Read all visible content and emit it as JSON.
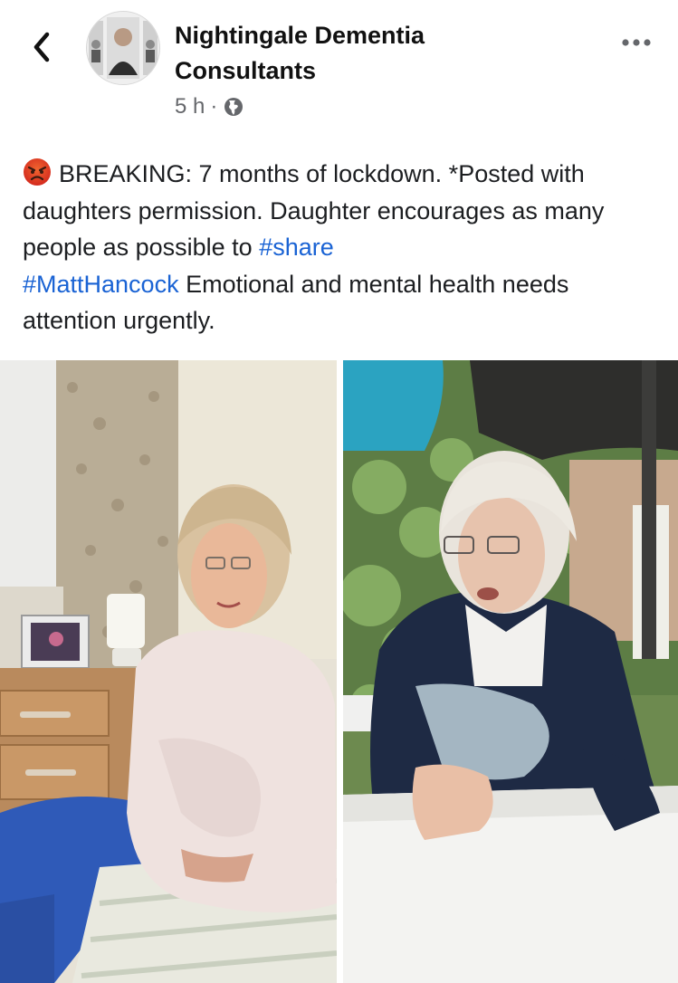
{
  "header": {
    "page_name_line1": "Nightingale Dementia",
    "page_name_line2": "Consultants",
    "timestamp": "5 h",
    "separator": "·",
    "audience_icon": "globe-icon",
    "back_icon": "chevron-left-icon",
    "more_icon": "more-horizontal-icon"
  },
  "post": {
    "emoji": "angry-face-icon",
    "text_before_share": "BREAKING: 7 months of lockdown. *Posted with daughters permission. Daughter encourages as many people as possible to ",
    "hashtag_share": "#share",
    "hashtag_matthancock": "#MattHancock",
    "text_after_hashtags": " Emotional and mental health needs attention urgently."
  },
  "photos": [
    {
      "name": "photo-left",
      "scene": "woman-in-pink-sweater-indoors"
    },
    {
      "name": "photo-right",
      "scene": "woman-in-navy-jacket-outdoors"
    }
  ],
  "colors": {
    "hashtag": "#1a63d4",
    "secondary_text": "#65676b",
    "background": "#ffffff"
  }
}
